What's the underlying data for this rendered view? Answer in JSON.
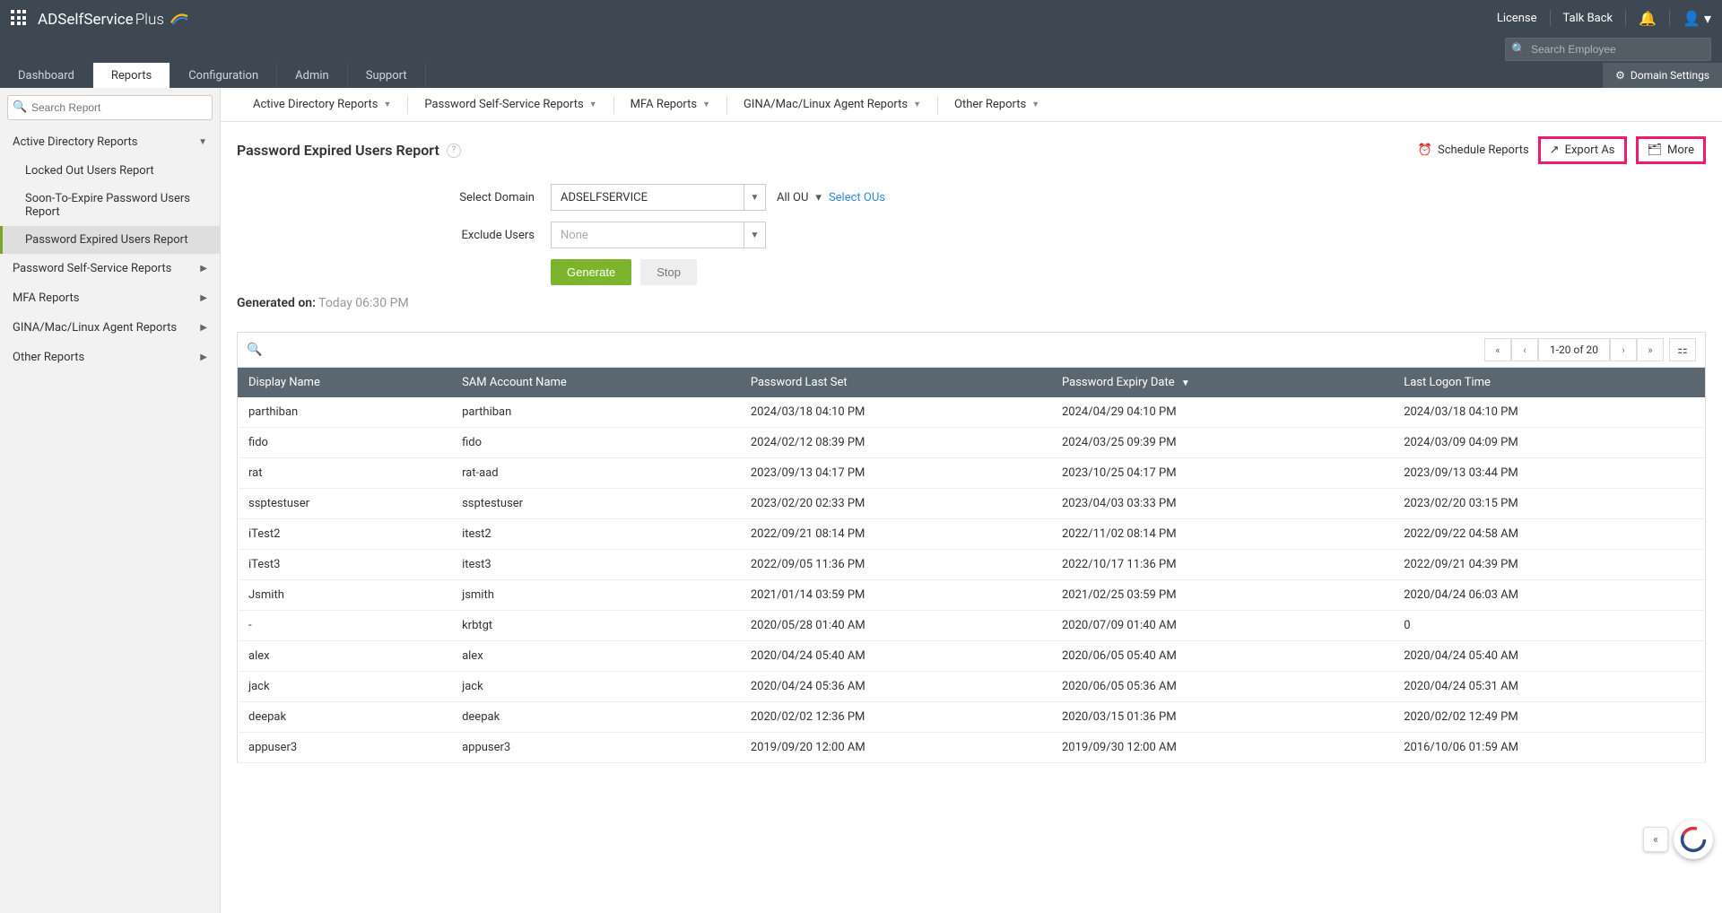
{
  "header": {
    "product": "ADSelfService",
    "product_suffix": "Plus",
    "license": "License",
    "talkback": "Talk Back",
    "search_placeholder": "Search Employee",
    "domain_settings": "Domain Settings"
  },
  "nav": {
    "dashboard": "Dashboard",
    "reports": "Reports",
    "configuration": "Configuration",
    "admin": "Admin",
    "support": "Support"
  },
  "sidebar": {
    "search_placeholder": "Search Report",
    "groups": {
      "adr": "Active Directory Reports",
      "pssr": "Password Self-Service Reports",
      "mfa": "MFA Reports",
      "gina": "GINA/Mac/Linux Agent Reports",
      "other": "Other Reports"
    },
    "adr_items": {
      "locked": "Locked Out Users Report",
      "soon": "Soon-To-Expire Password Users Report",
      "expired": "Password Expired Users Report"
    }
  },
  "subnav": {
    "adr": "Active Directory Reports",
    "pssr": "Password Self-Service Reports",
    "mfa": "MFA Reports",
    "gina": "GINA/Mac/Linux Agent Reports",
    "other": "Other Reports"
  },
  "page": {
    "title": "Password Expired Users Report",
    "schedule": "Schedule Reports",
    "export": "Export As",
    "more": "More",
    "select_domain_label": "Select Domain",
    "domain_value": "ADSELFSERVICE",
    "exclude_label": "Exclude Users",
    "exclude_value": "None",
    "all_ou": "All OU",
    "select_ous": "Select OUs",
    "generate": "Generate",
    "stop": "Stop",
    "generated_label": "Generated on:",
    "generated_time": "Today 06:30 PM",
    "pagination": "1-20 of 20"
  },
  "columns": {
    "display_name": "Display Name",
    "sam": "SAM Account Name",
    "pwd_last_set": "Password Last Set",
    "pwd_expiry": "Password Expiry Date",
    "last_logon": "Last Logon Time"
  },
  "rows": [
    {
      "dn": "parthiban",
      "sam": "parthiban",
      "pls": "2024/03/18 04:10 PM",
      "ped": "2024/04/29 04:10 PM",
      "llt": "2024/03/18 04:10 PM"
    },
    {
      "dn": "fido",
      "sam": "fido",
      "pls": "2024/02/12 08:39 PM",
      "ped": "2024/03/25 09:39 PM",
      "llt": "2024/03/09 04:09 PM"
    },
    {
      "dn": "rat",
      "sam": "rat-aad",
      "pls": "2023/09/13 04:17 PM",
      "ped": "2023/10/25 04:17 PM",
      "llt": "2023/09/13 03:44 PM"
    },
    {
      "dn": "ssptestuser",
      "sam": "ssptestuser",
      "pls": "2023/02/20 02:33 PM",
      "ped": "2023/04/03 03:33 PM",
      "llt": "2023/02/20 03:15 PM"
    },
    {
      "dn": "iTest2",
      "sam": "itest2",
      "pls": "2022/09/21 08:14 PM",
      "ped": "2022/11/02 08:14 PM",
      "llt": "2022/09/22 04:58 AM"
    },
    {
      "dn": "iTest3",
      "sam": "itest3",
      "pls": "2022/09/05 11:36 PM",
      "ped": "2022/10/17 11:36 PM",
      "llt": "2022/09/21 04:39 PM"
    },
    {
      "dn": "Jsmith",
      "sam": "jsmith",
      "pls": "2021/01/14 03:59 PM",
      "ped": "2021/02/25 03:59 PM",
      "llt": "2020/04/24 06:03 AM"
    },
    {
      "dn": "-",
      "sam": "krbtgt",
      "pls": "2020/05/28 01:40 AM",
      "ped": "2020/07/09 01:40 AM",
      "llt": "0"
    },
    {
      "dn": "alex",
      "sam": "alex",
      "pls": "2020/04/24 05:40 AM",
      "ped": "2020/06/05 05:40 AM",
      "llt": "2020/04/24 05:40 AM"
    },
    {
      "dn": "jack",
      "sam": "jack",
      "pls": "2020/04/24 05:36 AM",
      "ped": "2020/06/05 05:36 AM",
      "llt": "2020/04/24 05:31 AM"
    },
    {
      "dn": "deepak",
      "sam": "deepak",
      "pls": "2020/02/02 12:36 PM",
      "ped": "2020/03/15 01:36 PM",
      "llt": "2020/02/02 12:49 PM"
    },
    {
      "dn": "appuser3",
      "sam": "appuser3",
      "pls": "2019/09/20 12:00 AM",
      "ped": "2019/09/30 12:00 AM",
      "llt": "2016/10/06 01:59 AM"
    }
  ]
}
